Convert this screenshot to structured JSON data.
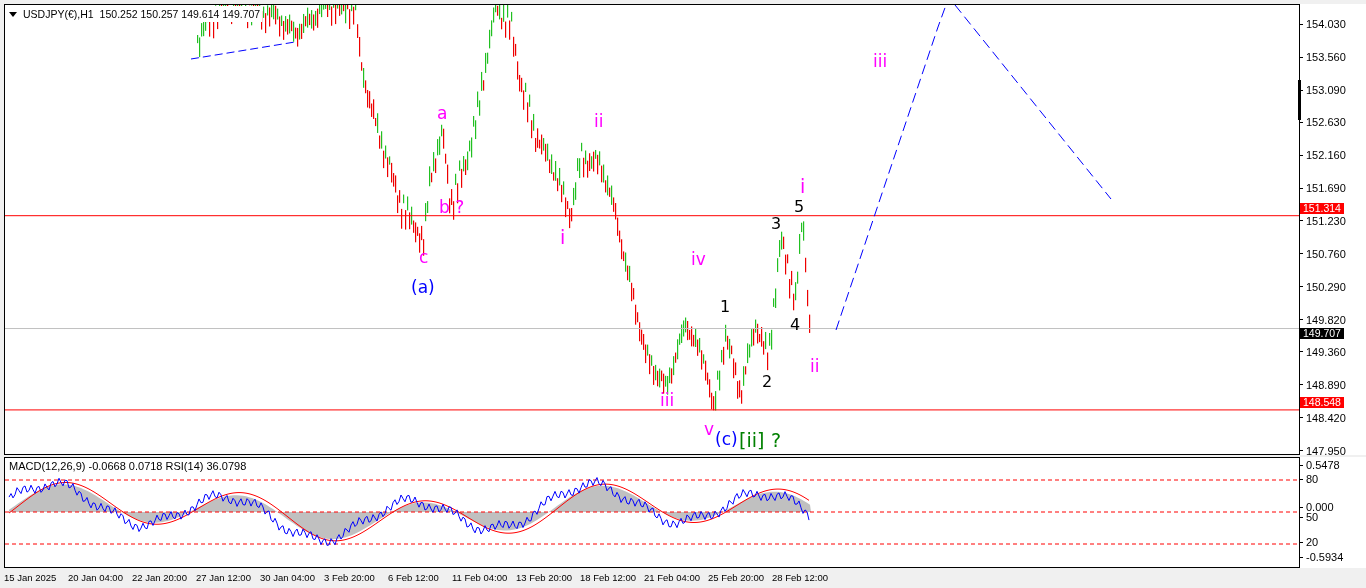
{
  "chart": {
    "symbol": "USDJPY(€),H1",
    "ohlc": "150.252 150.257 149.614 149.707",
    "price_ticks": [
      "154.030",
      "153.560",
      "153.090",
      "152.630",
      "152.160",
      "151.690",
      "151.230",
      "150.760",
      "150.290",
      "149.820",
      "149.360",
      "148.890",
      "148.420",
      "147.950"
    ],
    "levels": [
      {
        "price": "151.314",
        "kind": "line"
      },
      {
        "price": "149.707",
        "kind": "bid"
      },
      {
        "price": "148.548",
        "kind": "line"
      }
    ],
    "wave_labels": [
      {
        "text": "a",
        "color": "#ff00ff"
      },
      {
        "text": "b ?",
        "color": "#ff00ff"
      },
      {
        "text": "c",
        "color": "#ff00ff"
      },
      {
        "text": "(a)",
        "color": "#0000ff"
      },
      {
        "text": "ii",
        "color": "#ff00ff"
      },
      {
        "text": "i",
        "color": "#ff00ff"
      },
      {
        "text": "iii",
        "color": "#ff00ff"
      },
      {
        "text": "iv",
        "color": "#ff00ff"
      },
      {
        "text": "v",
        "color": "#ff00ff"
      },
      {
        "text": "(c)",
        "color": "#0000ff"
      },
      {
        "text": "[ii]",
        "color": "#008000"
      },
      {
        "text": "?",
        "color": "#008000"
      },
      {
        "text": "1",
        "color": "#000000"
      },
      {
        "text": "2",
        "color": "#000000"
      },
      {
        "text": "3",
        "color": "#000000"
      },
      {
        "text": "i",
        "color": "#ff00ff"
      },
      {
        "text": "5",
        "color": "#000000"
      },
      {
        "text": "4",
        "color": "#000000"
      },
      {
        "text": "ii",
        "color": "#ff00ff"
      },
      {
        "text": "iii",
        "color": "#ff00ff"
      }
    ]
  },
  "indicator": {
    "title": "MACD(12,26,9) -0.0668 0.0718  RSI(14) 36.0798",
    "ticks": [
      "0.5478",
      "80",
      "0.000",
      "50",
      "20",
      "-0.5934"
    ]
  },
  "time_axis": [
    "15 Jan 2025",
    "20 Jan 04:00",
    "22 Jan 20:00",
    "27 Jan 12:00",
    "30 Jan 04:00",
    "3 Feb 20:00",
    "6 Feb 12:00",
    "11 Feb 04:00",
    "13 Feb 20:00",
    "18 Feb 12:00",
    "21 Feb 04:00",
    "25 Feb 20:00",
    "28 Feb 12:00"
  ]
}
